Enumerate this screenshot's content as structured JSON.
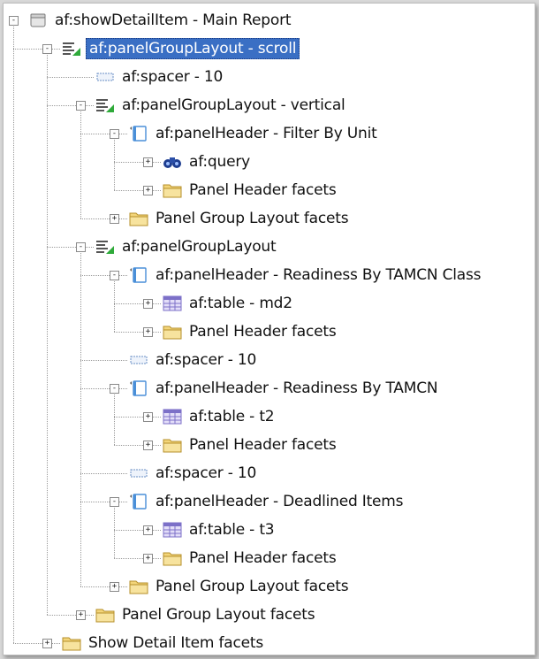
{
  "tree": {
    "nodes": [
      {
        "label": "af:showDetailItem - Main Report",
        "icon": "show-detail-item-icon",
        "toggle": "-"
      },
      {
        "label": "af:panelGroupLayout - scroll",
        "icon": "panel-group-layout-icon",
        "toggle": "-",
        "selected": true
      },
      {
        "label": "af:spacer - 10",
        "icon": "spacer-icon",
        "toggle": ""
      },
      {
        "label": "af:panelGroupLayout - vertical",
        "icon": "panel-group-layout-icon",
        "toggle": "-"
      },
      {
        "label": "af:panelHeader - Filter By Unit",
        "icon": "panel-header-icon",
        "toggle": "-"
      },
      {
        "label": "af:query",
        "icon": "binoculars-icon",
        "toggle": "+"
      },
      {
        "label": "Panel Header facets",
        "icon": "folder-icon",
        "toggle": "+"
      },
      {
        "label": "Panel Group Layout facets",
        "icon": "folder-icon",
        "toggle": "+"
      },
      {
        "label": "af:panelGroupLayout",
        "icon": "panel-group-layout-icon",
        "toggle": "-"
      },
      {
        "label": "af:panelHeader - Readiness By TAMCN Class",
        "icon": "panel-header-icon",
        "toggle": "-"
      },
      {
        "label": "af:table - md2",
        "icon": "table-icon",
        "toggle": "+"
      },
      {
        "label": "Panel Header facets",
        "icon": "folder-icon",
        "toggle": "+"
      },
      {
        "label": "af:spacer - 10",
        "icon": "spacer-icon",
        "toggle": ""
      },
      {
        "label": "af:panelHeader - Readiness By TAMCN",
        "icon": "panel-header-icon",
        "toggle": "-"
      },
      {
        "label": "af:table - t2",
        "icon": "table-icon",
        "toggle": "+"
      },
      {
        "label": "Panel Header facets",
        "icon": "folder-icon",
        "toggle": "+"
      },
      {
        "label": "af:spacer - 10",
        "icon": "spacer-icon",
        "toggle": ""
      },
      {
        "label": "af:panelHeader - Deadlined Items",
        "icon": "panel-header-icon",
        "toggle": "-"
      },
      {
        "label": "af:table - t3",
        "icon": "table-icon",
        "toggle": "+"
      },
      {
        "label": "Panel Header facets",
        "icon": "folder-icon",
        "toggle": "+"
      },
      {
        "label": "Panel Group Layout facets",
        "icon": "folder-icon",
        "toggle": "+"
      },
      {
        "label": "Panel Group Layout facets",
        "icon": "folder-icon",
        "toggle": "+"
      },
      {
        "label": "Show Detail Item facets",
        "icon": "folder-icon",
        "toggle": "+"
      }
    ]
  },
  "colors": {
    "selection": "#3a6fc4",
    "folder": "#f3d57a",
    "panel_header": "#4a8fd8",
    "table": "#7c70c8",
    "layout_accent": "#2faa3a"
  }
}
